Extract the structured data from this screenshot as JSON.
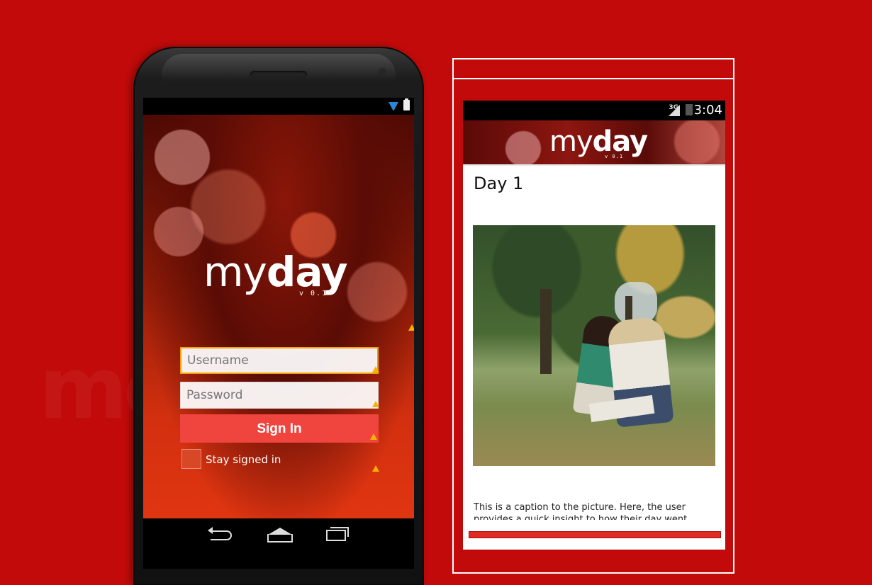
{
  "login_screen": {
    "logo_prefix": "my",
    "logo_suffix": "day",
    "version": "v 0.1",
    "username_placeholder": "Username",
    "password_placeholder": "Password",
    "sign_in_label": "Sign In",
    "stay_signed_in_label": "Stay signed in"
  },
  "entry_screen": {
    "clock": "3:04",
    "network_label": "3G",
    "logo_prefix": "my",
    "logo_suffix": "day",
    "version": "v 0.1",
    "day_title": "Day 1",
    "caption": "This is a caption to the picture. Here, the user provides a quick insight to how their day went."
  },
  "colors": {
    "background": "#c20a0a",
    "accent_button": "#f0453f",
    "wifi": "#2b86d6",
    "warning": "#f3b300"
  }
}
